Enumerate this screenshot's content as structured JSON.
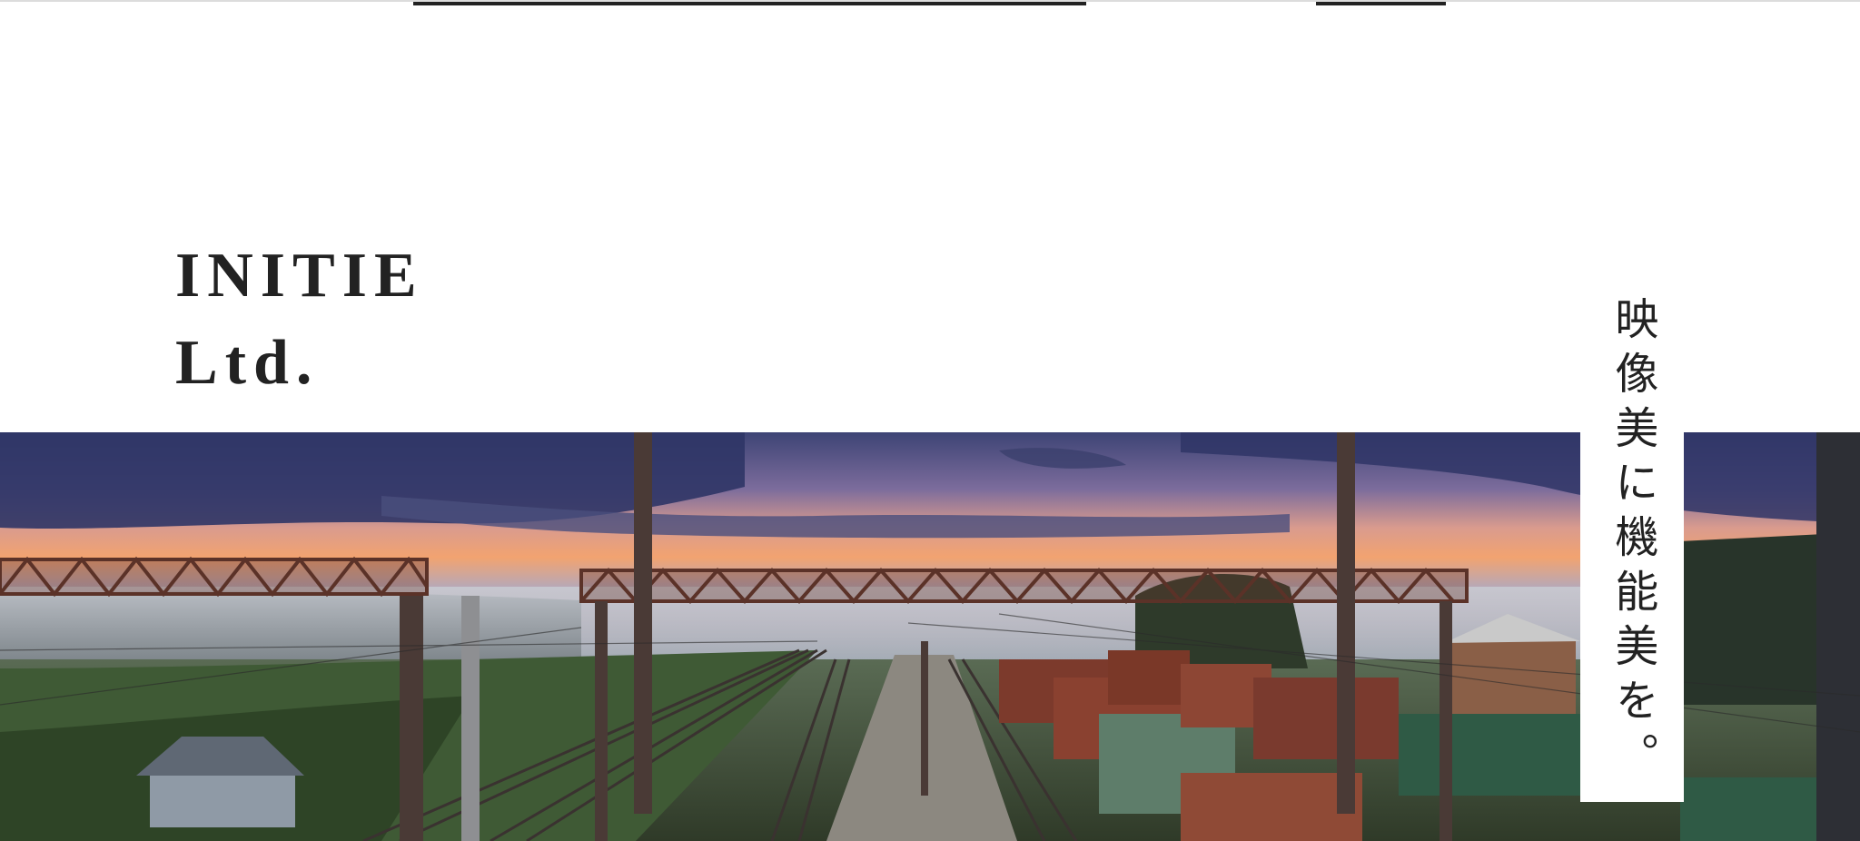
{
  "brand": {
    "line1": "INITIE",
    "line2": "Ltd."
  },
  "tagline": "映像美に機能美を。",
  "hero": {
    "image_name": "railway-yard-sunset-photo"
  },
  "colors": {
    "text": "#222222",
    "background": "#ffffff",
    "sky_top": "#3d4475",
    "sky_glow": "#f2a370",
    "ground": "#3a4a34"
  }
}
